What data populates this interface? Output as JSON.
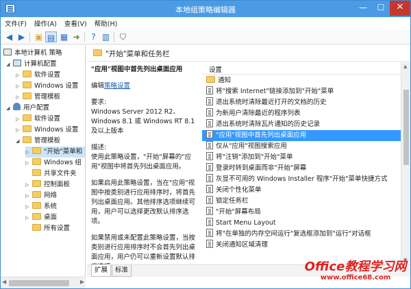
{
  "window": {
    "title": "本地组策略编辑器",
    "min": "—",
    "max": "☐",
    "close": "✕"
  },
  "menu": [
    "文件(F)",
    "操作(A)",
    "查看(V)",
    "帮助(H)"
  ],
  "tree": {
    "root": "本地计算机 策略",
    "computer_config": "计算机配置",
    "cc_software": "软件设置",
    "cc_windows": "Windows 设置",
    "cc_admin": "管理模板",
    "user_config": "用户配置",
    "uc_software": "软件设置",
    "uc_windows": "Windows 设置",
    "uc_admin": "管理模板",
    "admin_children": [
      "\"开始\"菜单和",
      "Windows 组",
      "共享文件夹",
      "控制面板",
      "网络",
      "系统",
      "桌面",
      "所有设置"
    ]
  },
  "panel": {
    "header_title": "\"开始\"菜单和任务栏",
    "desc_title": "\"应用\"视图中首先列出桌面应用",
    "edit_prefix": "编辑",
    "edit_link": "策略设置",
    "requirements_label": "要求:",
    "requirements_text": "Windows Server 2012 R2、Windows 8.1 或 Windows RT 8.1 及以上版本",
    "description_label": "描述:",
    "description_text": "使用此策略设置，\"开始\"屏幕的\"应用\"视图中将首先列出桌面应用。",
    "enabled_text": "如果启用此策略设置，当在\"应用\"视图中按类别进行应用排序时，将首先列出桌面应用。其他排序选项继续可用，用户可以选择更改默认排序选项。",
    "disabled_text": "如果禁用或未配置此策略设置，当按类别进行应用排序时不会首先列出桌面应用，用户仍可以重新设置默认排序选项。"
  },
  "list": {
    "header": "设置",
    "items": [
      {
        "label": "通知",
        "kind": "folder"
      },
      {
        "label": "将\"搜索 Internet\"链接添加到\"开始\"菜单",
        "kind": "policy"
      },
      {
        "label": "退出系统时清除最近打开的文档的历史",
        "kind": "policy"
      },
      {
        "label": "为新用户清除最近的程序列表",
        "kind": "policy"
      },
      {
        "label": "退出系统时清除瓦片通知的历史记录",
        "kind": "policy"
      },
      {
        "label": "\"应用\"视图中首先列出桌面应用",
        "kind": "policy",
        "selected": true
      },
      {
        "label": "仅从\"应用\"视图搜索应用",
        "kind": "policy"
      },
      {
        "label": "将\"注销\"添加到\"开始\"菜单",
        "kind": "policy"
      },
      {
        "label": "登录时转到桌面而非\"开始\"屏幕",
        "kind": "policy"
      },
      {
        "label": "灰显不可用的 Windows Installer 程序\"开始\"菜单快捷方式",
        "kind": "policy"
      },
      {
        "label": "关闭个性化菜单",
        "kind": "policy"
      },
      {
        "label": "锁定任务栏",
        "kind": "policy"
      },
      {
        "label": "\"开始\"屏幕布局",
        "kind": "policy"
      },
      {
        "label": "Start Menu Layout",
        "kind": "policy"
      },
      {
        "label": "将\"在单独的内存空间运行\"复选框添加到\"运行\"对话框",
        "kind": "policy"
      },
      {
        "label": "关闭通知区域清理",
        "kind": "policy"
      }
    ]
  },
  "tabs": {
    "extended": "扩展",
    "standard": "标准"
  },
  "watermark": {
    "line1": "Office教程学习网",
    "line2": "www.office68.com"
  },
  "colors": {
    "titlebar": "#4a9be4",
    "selection": "#3399ff",
    "close": "#c7372f"
  }
}
